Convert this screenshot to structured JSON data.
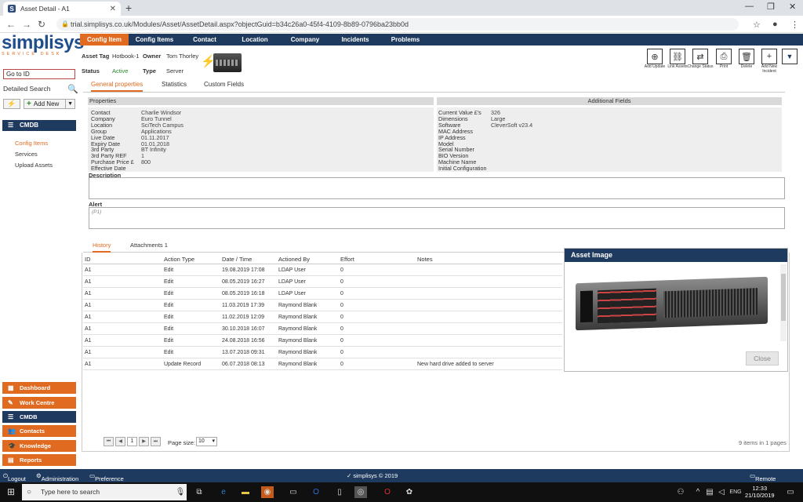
{
  "browser": {
    "tab_title": "Asset Detail - A1",
    "url": "trial.simplisys.co.uk/Modules/Asset/AssetDetail.aspx?objectGuid=b34c26a0-45f4-4109-8b89-0796ba23bb0d"
  },
  "logo": {
    "main": "simplisys",
    "sub": "SERVICE DESK"
  },
  "topnav": [
    "Config Item",
    "Config Items",
    "Contact",
    "Location",
    "Company",
    "Incidents",
    "Problems"
  ],
  "sidebar": {
    "goto_value": "Go to ID",
    "detailed_search": "Detailed Search",
    "add_new": "Add New",
    "cmdb": "CMDB",
    "items": [
      "Config Items",
      "Services",
      "Upload Assets"
    ],
    "bottom": [
      "Dashboard",
      "Work Centre",
      "CMDB",
      "Contacts",
      "Knowledge",
      "Reports"
    ]
  },
  "asset": {
    "tag_label": "Asset Tag",
    "tag": "Hotbook-1",
    "owner_label": "Owner",
    "owner": "Tom Thorley",
    "status_label": "Status",
    "status": "Active",
    "type_label": "Type",
    "type": "Server"
  },
  "subtabs": [
    "General properties",
    "Statistics",
    "Custom Fields"
  ],
  "toolbar": [
    "Add Update",
    "Link Assets",
    "Change Status",
    "Print",
    "Delete",
    "Add New Incident"
  ],
  "properties": {
    "heading": "Properties",
    "rows": [
      [
        "Contact",
        "Charlie Windsor"
      ],
      [
        "Company",
        "Euro Tunnel"
      ],
      [
        "Location",
        "SciTech Campus"
      ],
      [
        "Group",
        "Applications"
      ],
      [
        "Live Date",
        "01.11.2017"
      ],
      [
        "Expiry Date",
        "01.01.2018"
      ],
      [
        "3rd Party",
        "BT Infinity"
      ],
      [
        "3rd Party REF",
        "1"
      ],
      [
        "Purchase Price £",
        "800"
      ],
      [
        "Effective Date",
        ""
      ]
    ]
  },
  "additional": {
    "heading": "Additional Fields",
    "rows": [
      [
        "Current Value £'s",
        "326"
      ],
      [
        "Dimensions",
        "Large"
      ],
      [
        "Software",
        "CleverSoft v23.4"
      ],
      [
        "MAC Address",
        ""
      ],
      [
        "IP Address",
        ""
      ],
      [
        "Model",
        ""
      ],
      [
        "Serial Number",
        ""
      ],
      [
        "BIO Version",
        ""
      ],
      [
        "Machine Name",
        ""
      ],
      [
        "Initial Configuration",
        ""
      ]
    ]
  },
  "description_label": "Description",
  "alert_label": "Alert",
  "alert_value": "(P1)",
  "history": {
    "tabs": [
      "History",
      "Attachments 1"
    ],
    "columns": [
      "ID",
      "Action Type",
      "Date / Time",
      "Actioned By",
      "Effort",
      "Notes"
    ],
    "rows": [
      [
        "A1",
        "Edit",
        "19.08.2019 17:08",
        "LDAP User",
        "0",
        ""
      ],
      [
        "A1",
        "Edit",
        "08.05.2019 16:27",
        "LDAP User",
        "0",
        ""
      ],
      [
        "A1",
        "Edit",
        "08.05.2019 16:18",
        "LDAP User",
        "0",
        ""
      ],
      [
        "A1",
        "Edit",
        "11.03.2019 17:39",
        "Raymond Blank",
        "0",
        ""
      ],
      [
        "A1",
        "Edit",
        "11.02.2019 12:09",
        "Raymond Blank",
        "0",
        ""
      ],
      [
        "A1",
        "Edit",
        "30.10.2018 16:07",
        "Raymond Blank",
        "0",
        ""
      ],
      [
        "A1",
        "Edit",
        "24.08.2018 16:56",
        "Raymond Blank",
        "0",
        ""
      ],
      [
        "A1",
        "Edit",
        "13.07.2018 09:31",
        "Raymond Blank",
        "0",
        ""
      ],
      [
        "A1",
        "Update Record",
        "06.07.2018 08:13",
        "Raymond Blank",
        "0",
        "New hard drive added to server"
      ]
    ]
  },
  "asset_image": {
    "title": "Asset Image",
    "close": "Close"
  },
  "pager": {
    "page": "1",
    "size_label": "Page size:",
    "size": "10",
    "info": "9 items in 1 pages"
  },
  "footer": {
    "logout": "Logout",
    "admin": "Administration",
    "pref": "Preference",
    "brand": "✓ simplisys © 2019",
    "remote": "Remote Control"
  },
  "taskbar": {
    "search": "Type here to search",
    "time": "12:33",
    "date": "21/10/2019",
    "lang": "ENG"
  }
}
